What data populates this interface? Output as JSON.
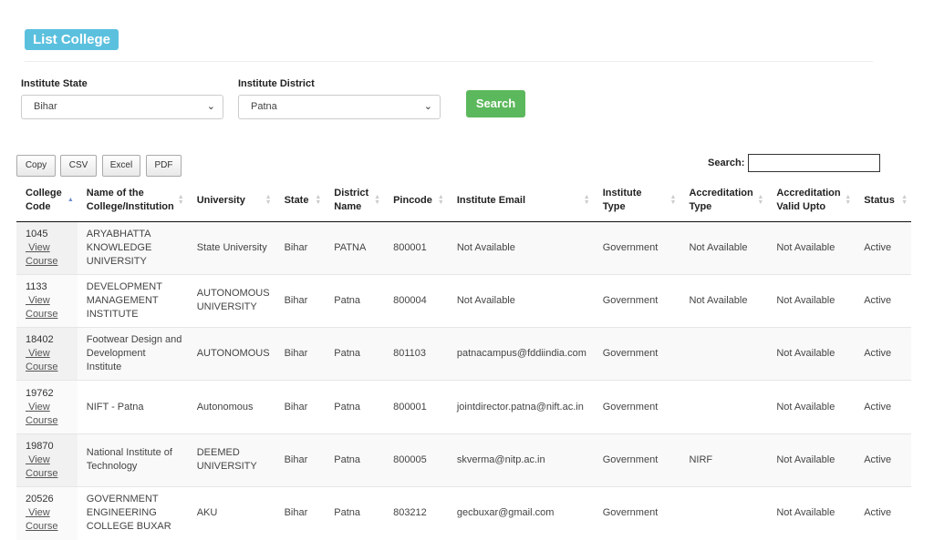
{
  "page_title": "List College",
  "filters": {
    "state_label": "Institute State",
    "state_value": "Bihar",
    "district_label": "Institute District",
    "district_value": "Patna",
    "search_button": "Search"
  },
  "export_buttons": [
    "Copy",
    "CSV",
    "Excel",
    "PDF"
  ],
  "table_search_label": "Search:",
  "columns": [
    {
      "line1": "College",
      "line2": "Code"
    },
    {
      "line1": "Name of the",
      "line2": "College/Institution"
    },
    {
      "line1": "University",
      "line2": ""
    },
    {
      "line1": "State",
      "line2": ""
    },
    {
      "line1": "District",
      "line2": "Name"
    },
    {
      "line1": "Pincode",
      "line2": ""
    },
    {
      "line1": "Institute Email",
      "line2": ""
    },
    {
      "line1": "Institute",
      "line2": "Type"
    },
    {
      "line1": "Accreditation",
      "line2": "Type"
    },
    {
      "line1": "Accreditation",
      "line2": "Valid Upto"
    },
    {
      "line1": "Status",
      "line2": ""
    }
  ],
  "view_link_line1": "View",
  "view_link_line2": "Course",
  "rows": [
    {
      "code": "1045",
      "name": [
        "ARYABHATTA",
        "KNOWLEDGE",
        "UNIVERSITY"
      ],
      "university": [
        "State University"
      ],
      "state": "Bihar",
      "district": "PATNA",
      "pincode": "800001",
      "email": "Not Available",
      "type": "Government",
      "accr_type": "Not Available",
      "accr_valid": "Not Available",
      "status": "Active"
    },
    {
      "code": "1133",
      "name": [
        "DEVELOPMENT",
        "MANAGEMENT",
        "INSTITUTE"
      ],
      "university": [
        "AUTONOMOUS",
        "UNIVERSITY"
      ],
      "state": "Bihar",
      "district": "Patna",
      "pincode": "800004",
      "email": "Not Available",
      "type": "Government",
      "accr_type": "Not Available",
      "accr_valid": "Not Available",
      "status": "Active"
    },
    {
      "code": "18402",
      "name": [
        "Footwear Design and",
        "Development Institute"
      ],
      "university": [
        "AUTONOMOUS"
      ],
      "state": "Bihar",
      "district": "Patna",
      "pincode": "801103",
      "email": "patnacampus@fddiindia.com",
      "type": "Government",
      "accr_type": "",
      "accr_valid": "Not Available",
      "status": "Active"
    },
    {
      "code": "19762",
      "name": [
        "NIFT - Patna"
      ],
      "university": [
        "Autonomous"
      ],
      "state": "Bihar",
      "district": "Patna",
      "pincode": "800001",
      "email": "jointdirector.patna@nift.ac.in",
      "type": "Government",
      "accr_type": "",
      "accr_valid": "Not Available",
      "status": "Active"
    },
    {
      "code": "19870",
      "name": [
        "National Institute of",
        "Technology"
      ],
      "university": [
        "DEEMED",
        "UNIVERSITY"
      ],
      "state": "Bihar",
      "district": "Patna",
      "pincode": "800005",
      "email": "skverma@nitp.ac.in",
      "type": "Government",
      "accr_type": "NIRF",
      "accr_valid": "Not Available",
      "status": "Active"
    },
    {
      "code": "20526",
      "name": [
        "GOVERNMENT",
        "ENGINEERING",
        "COLLEGE BUXAR"
      ],
      "university": [
        "AKU"
      ],
      "state": "Bihar",
      "district": "Patna",
      "pincode": "803212",
      "email": "gecbuxar@gmail.com",
      "type": "Government",
      "accr_type": "",
      "accr_valid": "Not Available",
      "status": "Active"
    }
  ]
}
